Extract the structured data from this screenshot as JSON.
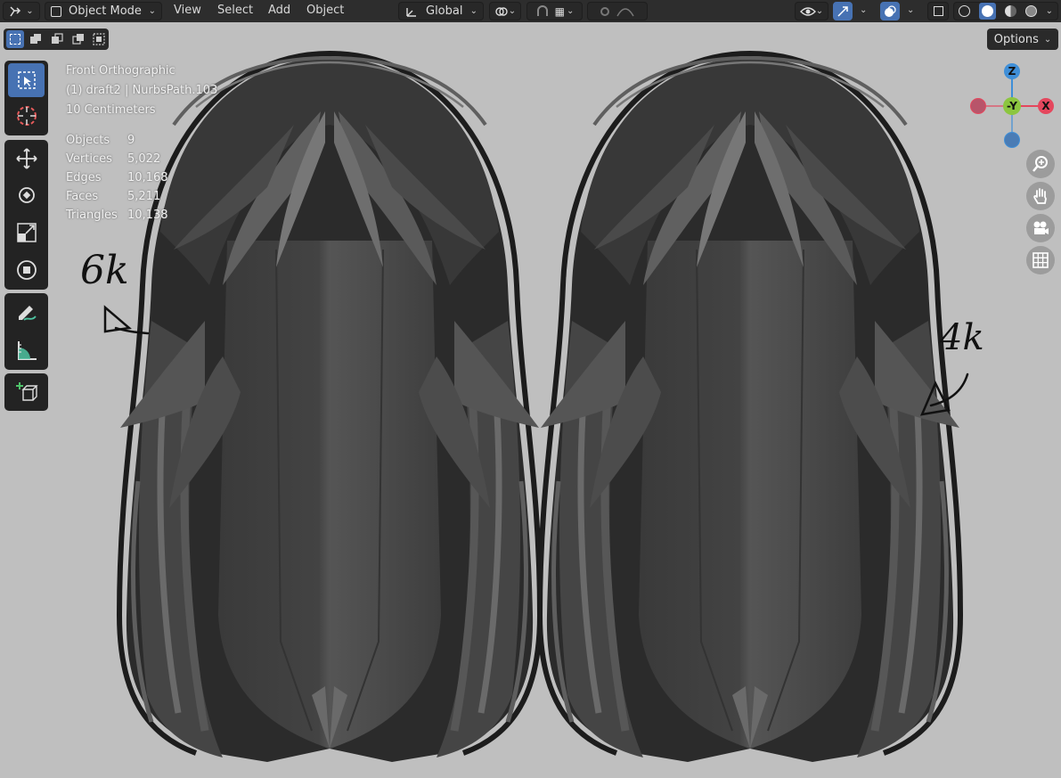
{
  "header": {
    "mode": "Object Mode",
    "menus": [
      "View",
      "Select",
      "Add",
      "Object"
    ],
    "transform_orientation": "Global"
  },
  "options_label": "Options",
  "viewport": {
    "view_name": "Front Orthographic",
    "object_info": "(1) draft2 | NurbsPath.103",
    "scale": "10 Centimeters"
  },
  "stats": [
    {
      "label": "Objects",
      "value": "9"
    },
    {
      "label": "Vertices",
      "value": "5,022"
    },
    {
      "label": "Edges",
      "value": "10,168"
    },
    {
      "label": "Faces",
      "value": "5,211"
    },
    {
      "label": "Triangles",
      "value": "10,138"
    }
  ],
  "annotations": {
    "left": "6k",
    "right": "4k"
  },
  "gizmo": {
    "z": "Z",
    "neg_y": "-Y",
    "x": "X"
  },
  "colors": {
    "accent": "#4772b3",
    "axis_x": "#e5475d",
    "axis_y": "#8cc63f",
    "axis_z": "#3f8fd8"
  }
}
